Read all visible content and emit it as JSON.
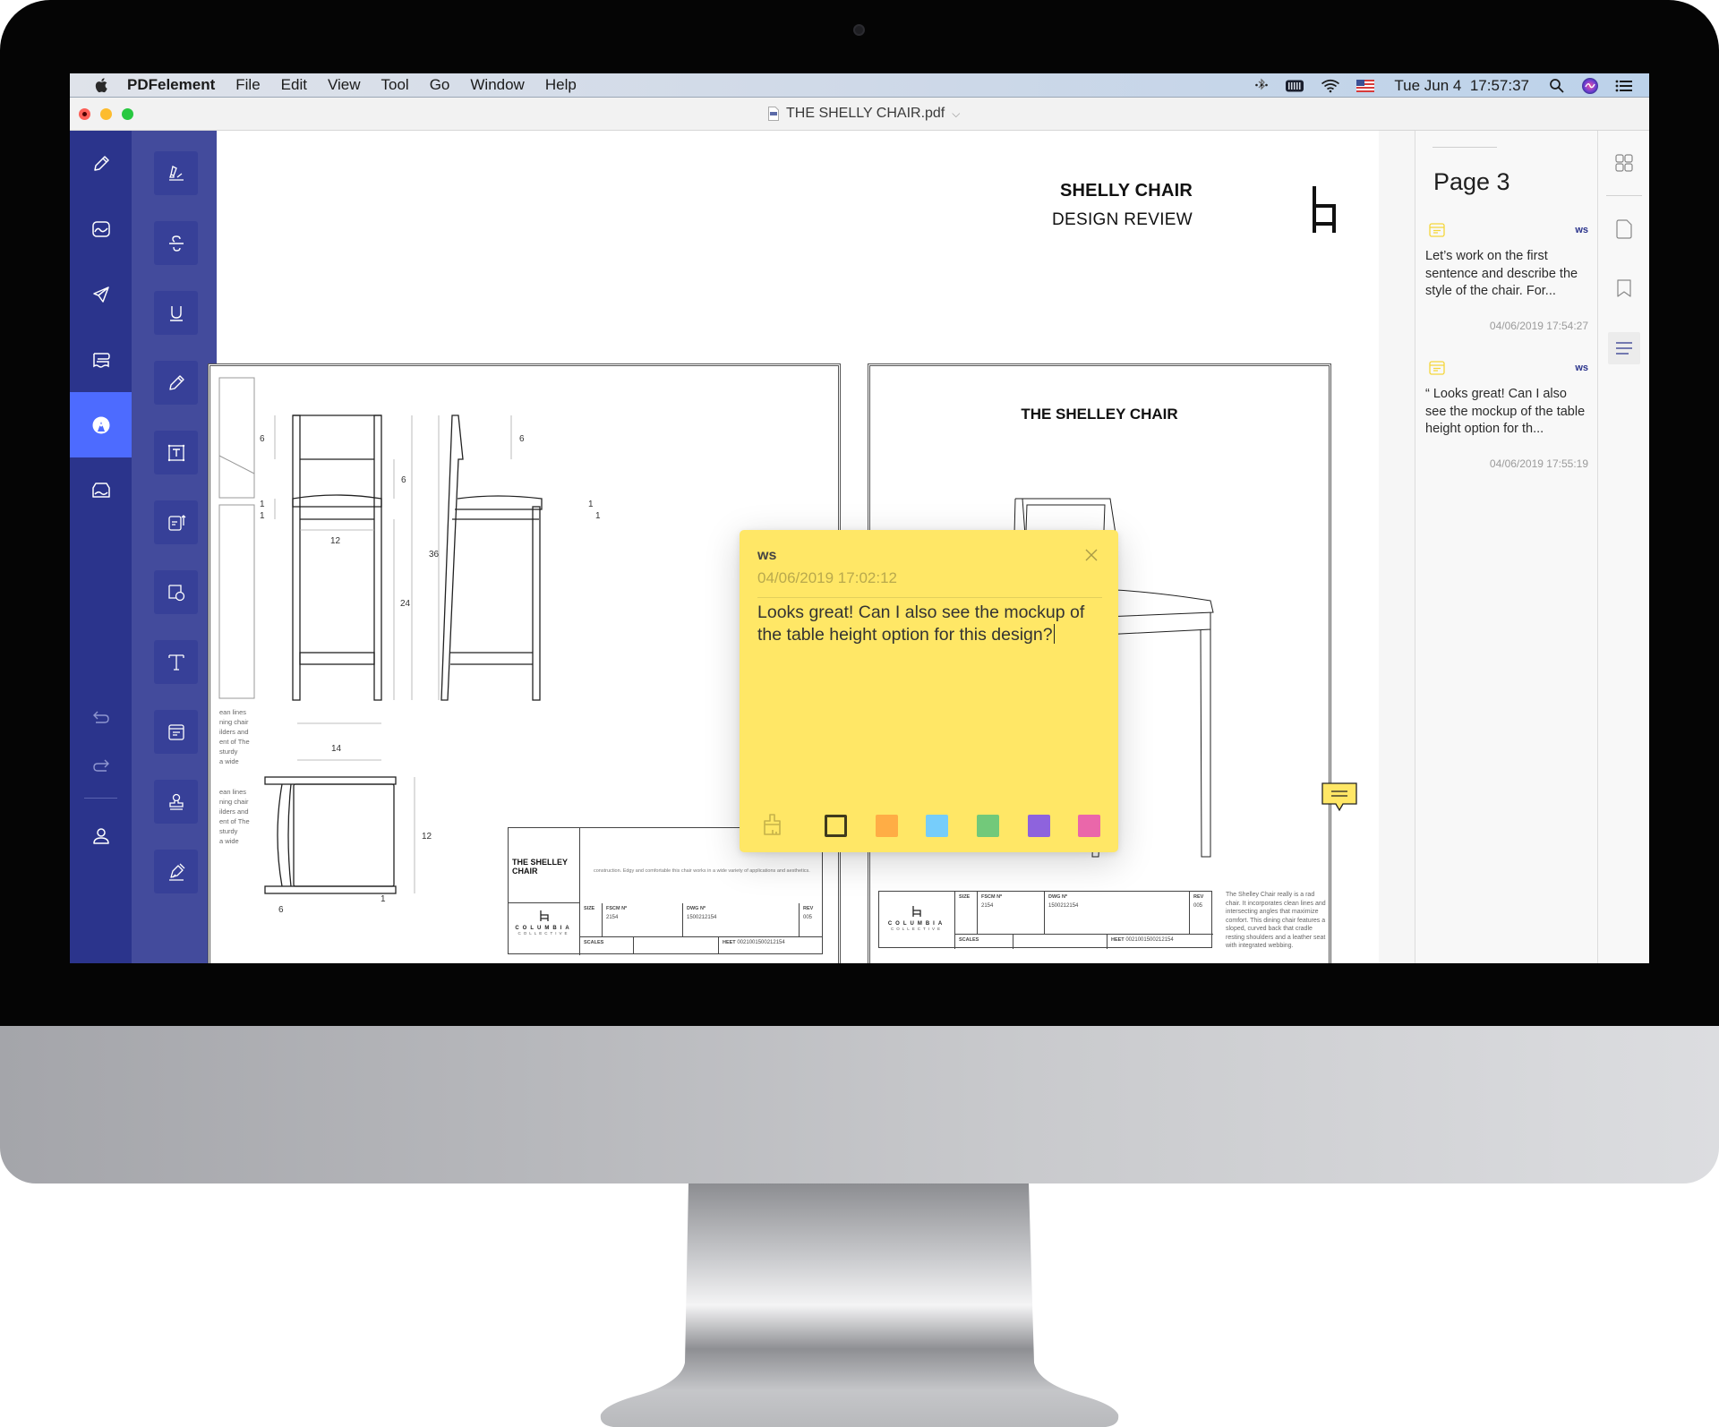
{
  "menubar": {
    "app_name": "PDFelement",
    "menus": [
      "File",
      "Edit",
      "View",
      "Tool",
      "Go",
      "Window",
      "Help"
    ],
    "clock": "Tue Jun 4  17:57:37",
    "status_icons": [
      "bluetooth-icon",
      "battery-icon",
      "wifi-icon",
      "us-flag-input-icon",
      "spotlight-search-icon",
      "siri-icon",
      "notification-center-icon"
    ]
  },
  "window": {
    "title": "THE SHELLY CHAIR.pdf"
  },
  "left_nav": {
    "items": [
      {
        "name": "edit",
        "icon": "pencil-icon",
        "active": false
      },
      {
        "name": "image",
        "icon": "image-icon",
        "active": false
      },
      {
        "name": "share",
        "icon": "send-icon",
        "active": false
      },
      {
        "name": "organize",
        "icon": "pages-icon",
        "active": false
      },
      {
        "name": "comment",
        "icon": "comment-pen-icon",
        "active": true
      },
      {
        "name": "form",
        "icon": "inbox-icon",
        "active": false
      }
    ],
    "bottom": [
      {
        "name": "undo",
        "icon": "undo-icon"
      },
      {
        "name": "redo",
        "icon": "redo-icon"
      },
      {
        "name": "account",
        "icon": "user-icon"
      }
    ]
  },
  "tools": [
    {
      "name": "highlight",
      "icon": "highlight-icon"
    },
    {
      "name": "strikethrough",
      "icon": "strikethrough-icon"
    },
    {
      "name": "underline",
      "icon": "underline-icon"
    },
    {
      "name": "pencil",
      "icon": "pencil-icon"
    },
    {
      "name": "text-box",
      "icon": "text-box-icon"
    },
    {
      "name": "text-callout",
      "icon": "callout-icon"
    },
    {
      "name": "shapes",
      "icon": "shapes-icon"
    },
    {
      "name": "typewriter",
      "icon": "text-icon"
    },
    {
      "name": "sticky-note",
      "icon": "note-icon"
    },
    {
      "name": "stamp",
      "icon": "stamp-icon"
    },
    {
      "name": "signature",
      "icon": "signature-pen-icon"
    }
  ],
  "document": {
    "header_title": "SHELLY CHAIR",
    "header_subtitle": "DESIGN REVIEW",
    "sheet2_title": "THE SHELLEY CHAIR",
    "dimensions": {
      "front_top": "6",
      "front_mid": "6",
      "front_seat1": "1",
      "front_seat2": "1",
      "front_width": "12",
      "front_leg": "24",
      "overall": "36",
      "side_top": "6",
      "side_seat1": "1",
      "side_seat2": "1",
      "top_width": "14",
      "top_depth": "12",
      "top_offset": "6",
      "top_leg": "1"
    },
    "side_description": "The Shelley Chair really is a rad chair. It incorporates clean lines and intersecting angles that maximize comfort. This dining chair features a sloped, curved back that cradle resting shoulders and a leather seat with integrated webbing.",
    "left_snippet": [
      "ean lines",
      "ning chair",
      "ilders and",
      "ent of The",
      "sturdy",
      "a wide"
    ],
    "title_block": {
      "chair_name": "THE SHELLEY CHAIR",
      "description": "construction. Edgy and comfortable this chair works in a wide variety of applications and aesthetics.",
      "brand": "COLUMBIA",
      "brand_sub": "COLLECTIVE",
      "size_label": "SIZE",
      "fscm_label": "FSCM Nº",
      "fscm_value": "2154",
      "dwg_label": "DWG Nº",
      "dwg_value": "1500212154",
      "rev_label": "REV",
      "rev_value": "005",
      "scales_label": "SCALES",
      "sheet_label": "HEET",
      "sheet_value": "0021001500212154"
    }
  },
  "sticky_note": {
    "author": "ws",
    "timestamp": "04/06/2019 17:02:12",
    "text": "Looks great! Can I also see the mockup of the table height option for this design?",
    "colors": [
      {
        "name": "yellow",
        "hex": "#ffe766",
        "selected": true
      },
      {
        "name": "orange",
        "hex": "#ffad45",
        "selected": false
      },
      {
        "name": "blue",
        "hex": "#76cdfb",
        "selected": false
      },
      {
        "name": "green",
        "hex": "#72c97a",
        "selected": false
      },
      {
        "name": "purple",
        "hex": "#8e63dd",
        "selected": false
      },
      {
        "name": "pink",
        "hex": "#ea67aa",
        "selected": false
      }
    ]
  },
  "comments_panel": {
    "page_label": "Page 3",
    "comments": [
      {
        "author": "ws",
        "text": "Let’s work on the first sentence and describe the style of the chair. For...",
        "date": "04/06/2019 17:54:27"
      },
      {
        "author": "ws",
        "text": "“ Looks great! Can I also see the mockup of the table height option for th...",
        "date": "04/06/2019 17:55:19"
      }
    ]
  },
  "right_rail": {
    "items": [
      {
        "name": "thumbnails",
        "icon": "grid-icon",
        "active": false
      },
      {
        "name": "pages",
        "icon": "page-icon",
        "active": false
      },
      {
        "name": "bookmarks",
        "icon": "bookmark-icon",
        "active": false
      },
      {
        "name": "annotations",
        "icon": "list-icon",
        "active": true
      }
    ]
  },
  "colors": {
    "nav_bg": "#2b348c",
    "tool_bg": "#434b9c",
    "active_accent": "#4d6bff",
    "note_yellow": "#ffe766"
  }
}
